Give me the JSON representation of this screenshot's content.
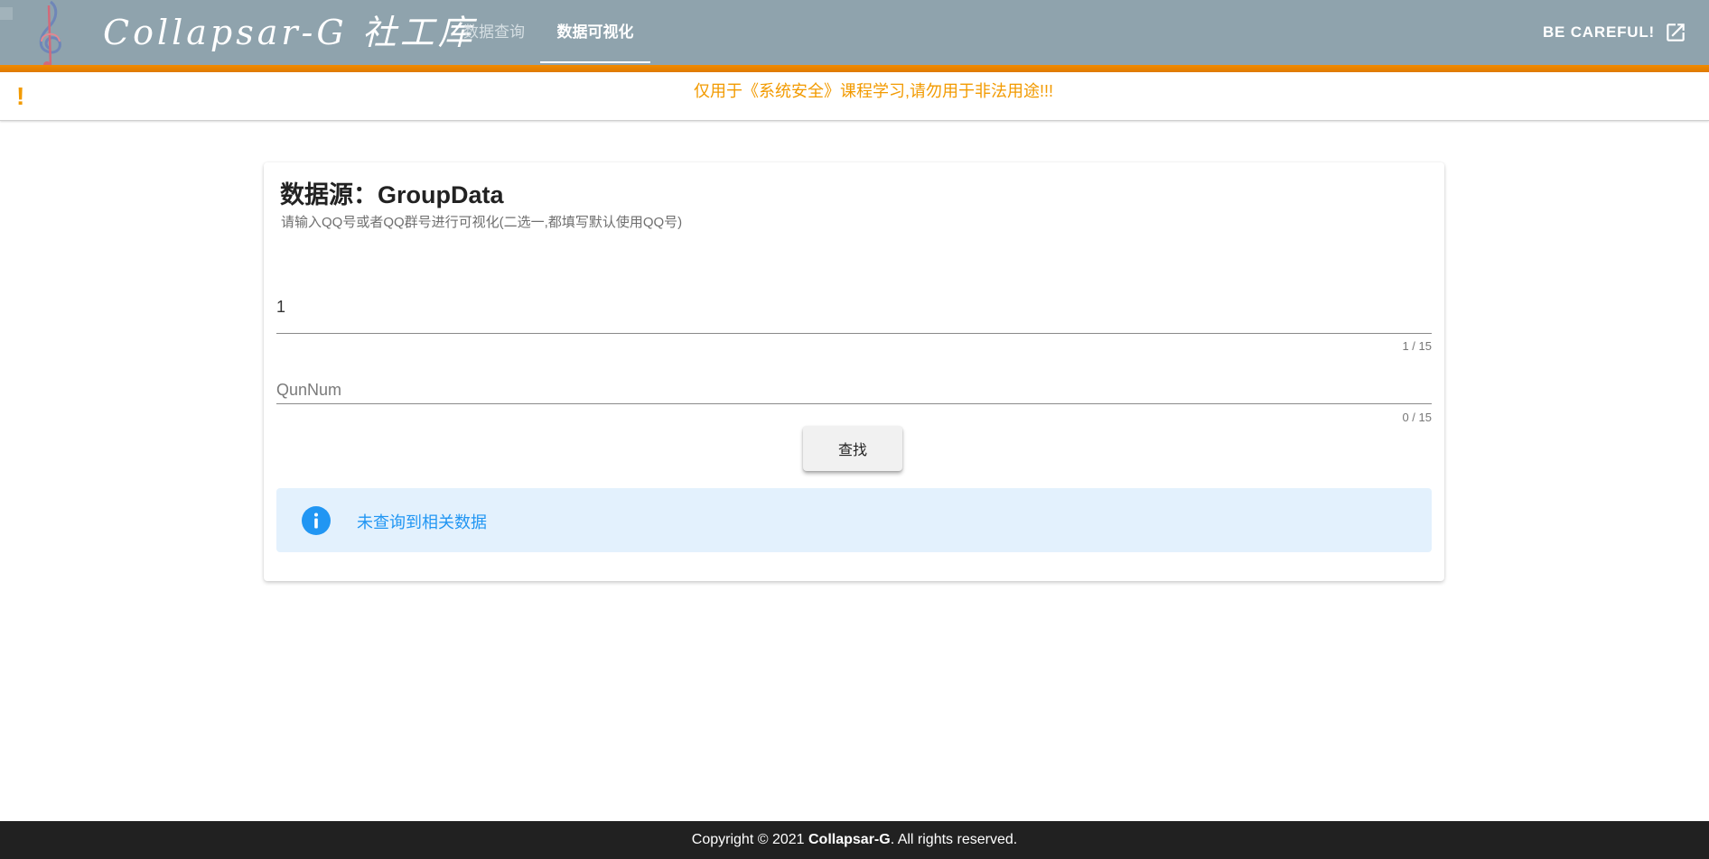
{
  "appbar": {
    "brand": "Collapsar-G 社工库",
    "tabs": [
      {
        "label": "数据查询",
        "active": false
      },
      {
        "label": "数据可视化",
        "active": true
      }
    ],
    "careful_label": "BE CAREFUL!",
    "careful_icon": "open-in-new-icon",
    "accent_color": "#f08a00",
    "bar_color": "#8fa3ad"
  },
  "banner": {
    "icon": "!",
    "text": "仅用于《系统安全》课程学习,请勿用于非法用途!!!",
    "color": "#f29a00"
  },
  "card": {
    "title": "数据源：GroupData",
    "subtitle": "请输入QQ号或者QQ群号进行可视化(二选一,都填写默认使用QQ号)",
    "qq_field": {
      "value": "1",
      "placeholder": "",
      "counter": "1 / 15"
    },
    "qun_field": {
      "value": "",
      "placeholder": "QunNum",
      "counter": "0 / 15"
    },
    "search_label": "查找",
    "alert": {
      "icon": "info-icon",
      "text": "未查询到相关数据",
      "color": "#2196f3",
      "background": "#e3f1fd"
    }
  },
  "footer": {
    "prefix": "Copyright © 2021 ",
    "brand": "Collapsar-G",
    "suffix": ". All rights reserved."
  }
}
